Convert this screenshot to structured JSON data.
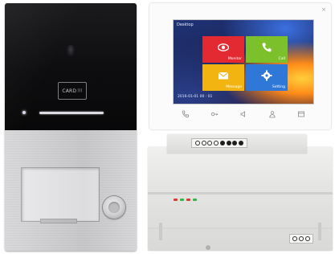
{
  "door_station": {
    "card_reader_label": "CARD"
  },
  "monitor": {
    "close_glyph": "×",
    "screen": {
      "header": "Desktop",
      "tiles": [
        {
          "label": "Monitor",
          "color": "#e32a32",
          "icon": "eye-icon"
        },
        {
          "label": "Call",
          "color": "#7cc12c",
          "icon": "phone-icon"
        },
        {
          "label": "Message",
          "color": "#f2b410",
          "icon": "envelope-icon"
        },
        {
          "label": "Setting",
          "color": "#2f78d8",
          "icon": "gear-icon"
        }
      ],
      "datetime": "2016-01-01 00 : 01"
    },
    "buttons": [
      "phone-icon",
      "unlock-key-icon",
      "speaker-icon",
      "user-icon",
      "menu-icon"
    ]
  },
  "power_supply": {
    "leds": [
      "#e03a2e",
      "#2fb84a",
      "#e03a2e",
      "#2fb84a"
    ]
  }
}
